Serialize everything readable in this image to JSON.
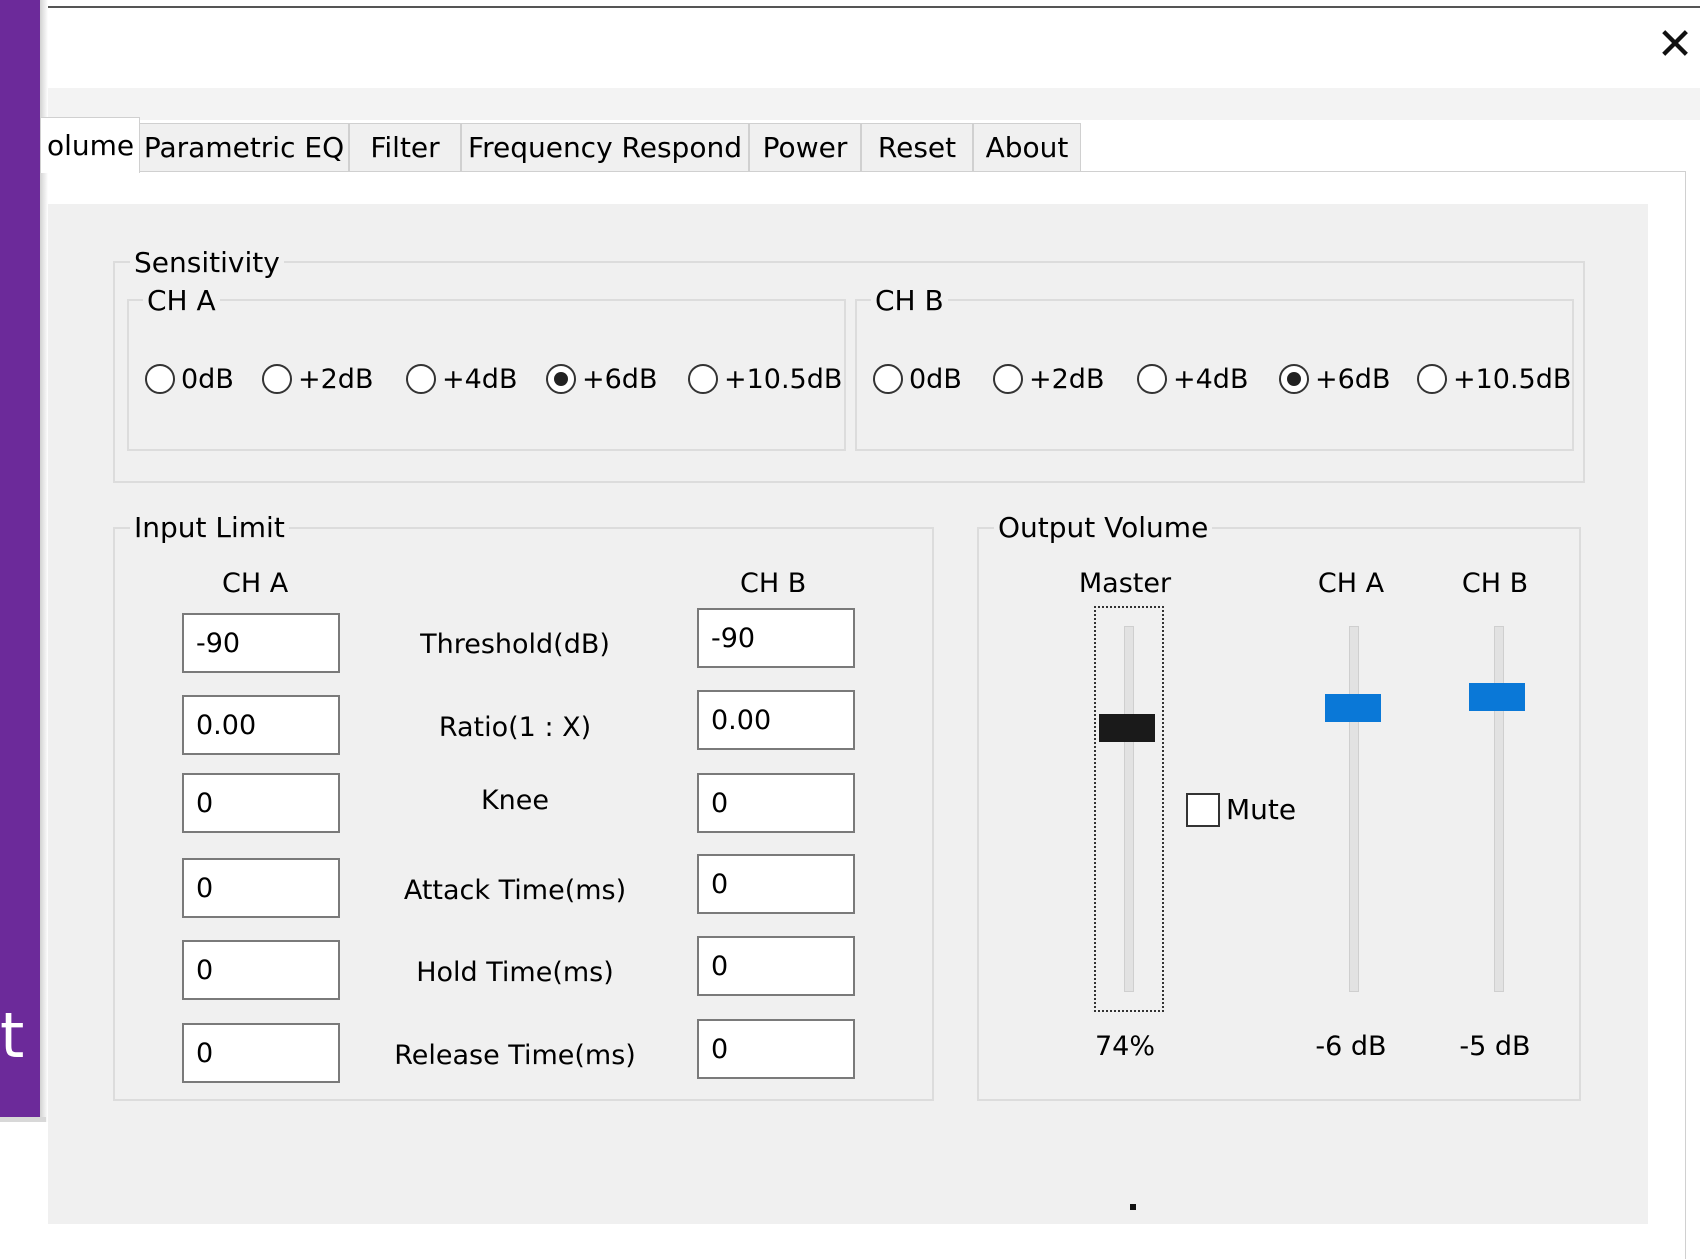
{
  "left_panel": {
    "char": "t",
    "color": "#6c2a9a"
  },
  "window": {
    "close_icon": "close-icon"
  },
  "tabs": [
    {
      "label": "olume",
      "active": true
    },
    {
      "label": "Parametric EQ"
    },
    {
      "label": "Filter"
    },
    {
      "label": "Frequency Respond"
    },
    {
      "label": "Power"
    },
    {
      "label": "Reset"
    },
    {
      "label": "About"
    }
  ],
  "sensitivity": {
    "title": "Sensitivity",
    "ch_a": {
      "title": "CH A",
      "options": [
        "0dB",
        "+2dB",
        "+4dB",
        "+6dB",
        "+10.5dB"
      ],
      "selected": "+6dB"
    },
    "ch_b": {
      "title": "CH B",
      "options": [
        "0dB",
        "+2dB",
        "+4dB",
        "+6dB",
        "+10.5dB"
      ],
      "selected": "+6dB"
    }
  },
  "input_limit": {
    "title": "Input Limit",
    "ch_a_header": "CH A",
    "ch_b_header": "CH B",
    "rows": [
      {
        "label": "Threshold(dB)",
        "ch_a": "-90",
        "ch_b": "-90"
      },
      {
        "label": "Ratio(1 : X)",
        "ch_a": "0.00",
        "ch_b": "0.00"
      },
      {
        "label": "Knee",
        "ch_a": "0",
        "ch_b": "0"
      },
      {
        "label": "Attack Time(ms)",
        "ch_a": "0",
        "ch_b": "0"
      },
      {
        "label": "Hold Time(ms)",
        "ch_a": "0",
        "ch_b": "0"
      },
      {
        "label": "Release Time(ms)",
        "ch_a": "0",
        "ch_b": "0"
      }
    ]
  },
  "output_volume": {
    "title": "Output Volume",
    "master": {
      "label": "Master",
      "value": "74%",
      "level": 0.74,
      "thumb_color": "#1a1a1a"
    },
    "mute": {
      "label": "Mute",
      "checked": false
    },
    "ch_a": {
      "label": "CH A",
      "value": "-6 dB",
      "level": 0.8,
      "thumb_color": "#0a78d7"
    },
    "ch_b": {
      "label": "CH B",
      "value": "-5 dB",
      "level": 0.83,
      "thumb_color": "#0a78d7"
    }
  }
}
